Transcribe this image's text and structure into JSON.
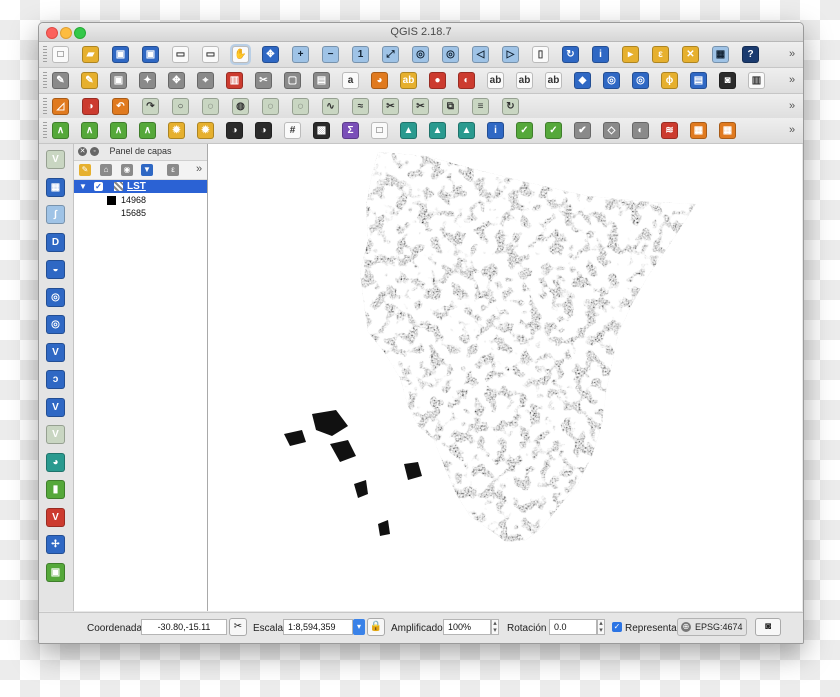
{
  "window": {
    "title": "QGIS 2.18.7"
  },
  "toolbars": {
    "more_glyph": "»",
    "row1": [
      {
        "name": "new-project",
        "glyph": "□",
        "color": "c-w"
      },
      {
        "name": "open-project",
        "glyph": "▰",
        "color": "c-y"
      },
      {
        "name": "save-project",
        "glyph": "▣",
        "color": "c-b"
      },
      {
        "name": "save-as",
        "glyph": "▣",
        "color": "c-b"
      },
      {
        "name": "new-print-composer",
        "glyph": "▭",
        "color": "c-w"
      },
      {
        "name": "composer-manager",
        "glyph": "▭",
        "color": "c-w"
      },
      {
        "name": "pan",
        "glyph": "✋",
        "color": "c-w"
      },
      {
        "name": "pan-to-selection",
        "glyph": "✥",
        "color": "c-b"
      },
      {
        "name": "zoom-in",
        "glyph": "+",
        "color": "c-lb"
      },
      {
        "name": "zoom-out",
        "glyph": "−",
        "color": "c-lb"
      },
      {
        "name": "zoom-native",
        "glyph": "1",
        "color": "c-lb"
      },
      {
        "name": "zoom-full",
        "glyph": "⤢",
        "color": "c-lb"
      },
      {
        "name": "zoom-to-selection",
        "glyph": "◎",
        "color": "c-lb"
      },
      {
        "name": "zoom-to-layer",
        "glyph": "◎",
        "color": "c-lb"
      },
      {
        "name": "zoom-last",
        "glyph": "◁",
        "color": "c-lb"
      },
      {
        "name": "zoom-next",
        "glyph": "▷",
        "color": "c-lb"
      },
      {
        "name": "bookmark",
        "glyph": "▯",
        "color": "c-w"
      },
      {
        "name": "refresh",
        "glyph": "↻",
        "color": "c-b"
      },
      {
        "name": "identify",
        "glyph": "i",
        "color": "c-b"
      },
      {
        "name": "select",
        "glyph": "▸",
        "color": "c-y"
      },
      {
        "name": "select-by-expression",
        "glyph": "ε",
        "color": "c-y"
      },
      {
        "name": "deselect",
        "glyph": "✕",
        "color": "c-y"
      },
      {
        "name": "attribute-table",
        "glyph": "▦",
        "color": "c-lb"
      },
      {
        "name": "help",
        "glyph": "?",
        "color": "c-navy"
      }
    ],
    "row2": [
      {
        "name": "current-edits",
        "glyph": "✎",
        "color": "c-gr"
      },
      {
        "name": "toggle-editing",
        "glyph": "✎",
        "color": "c-y"
      },
      {
        "name": "save-edits",
        "glyph": "▣",
        "color": "c-gr"
      },
      {
        "name": "add-feature",
        "glyph": "✦",
        "color": "c-gr"
      },
      {
        "name": "move-feature",
        "glyph": "✥",
        "color": "c-gr"
      },
      {
        "name": "node-tool",
        "glyph": "⌖",
        "color": "c-gr"
      },
      {
        "name": "delete-selected",
        "glyph": "▥",
        "color": "c-r"
      },
      {
        "name": "cut-features",
        "glyph": "✂",
        "color": "c-gr"
      },
      {
        "name": "copy-features",
        "glyph": "▢",
        "color": "c-gr"
      },
      {
        "name": "paste-features",
        "glyph": "▤",
        "color": "c-gr"
      },
      {
        "name": "label-toolbar",
        "glyph": "a",
        "color": "c-w"
      },
      {
        "name": "label-diagram",
        "glyph": "◕",
        "color": "c-o"
      },
      {
        "name": "label-layer",
        "glyph": "ab",
        "color": "c-y"
      },
      {
        "name": "pin-labels",
        "glyph": "●",
        "color": "c-r"
      },
      {
        "name": "show-hide-labels",
        "glyph": "◐",
        "color": "c-r"
      },
      {
        "name": "move-label",
        "glyph": "ab",
        "color": "c-w"
      },
      {
        "name": "rotate-label",
        "glyph": "ab",
        "color": "c-w"
      },
      {
        "name": "change-label",
        "glyph": "ab",
        "color": "c-w"
      },
      {
        "name": "database-manager",
        "glyph": "◆",
        "color": "c-b"
      },
      {
        "name": "web-layer",
        "glyph": "◎",
        "color": "c-b"
      },
      {
        "name": "wms-layer",
        "glyph": "◎",
        "color": "c-b"
      },
      {
        "name": "python-console",
        "glyph": "ϕ",
        "color": "c-y"
      },
      {
        "name": "map-tool",
        "glyph": "▤",
        "color": "c-b"
      },
      {
        "name": "screenshot",
        "glyph": "◙",
        "color": "c-k"
      },
      {
        "name": "copy-map",
        "glyph": "▥",
        "color": "c-w"
      }
    ],
    "row3": [
      {
        "name": "measure-line",
        "glyph": "◿",
        "color": "c-o"
      },
      {
        "name": "georeferencer",
        "glyph": "◑",
        "color": "c-r"
      },
      {
        "name": "undo",
        "glyph": "↶",
        "color": "c-o"
      },
      {
        "name": "redo",
        "glyph": "↷",
        "color": "c-lg"
      },
      {
        "name": "add-ring",
        "glyph": "○",
        "color": "c-lg"
      },
      {
        "name": "add-part",
        "glyph": "◌",
        "color": "c-lg"
      },
      {
        "name": "fill-ring",
        "glyph": "◍",
        "color": "c-lg"
      },
      {
        "name": "delete-ring",
        "glyph": "◌",
        "color": "c-lg"
      },
      {
        "name": "delete-part",
        "glyph": "◌",
        "color": "c-lg"
      },
      {
        "name": "reshape-features",
        "glyph": "∿",
        "color": "c-lg"
      },
      {
        "name": "offset-curve",
        "glyph": "≈",
        "color": "c-lg"
      },
      {
        "name": "split-features",
        "glyph": "✂",
        "color": "c-lg"
      },
      {
        "name": "split-parts",
        "glyph": "✂",
        "color": "c-lg"
      },
      {
        "name": "merge-features",
        "glyph": "⧉",
        "color": "c-lg"
      },
      {
        "name": "merge-attributes",
        "glyph": "≡",
        "color": "c-lg"
      },
      {
        "name": "rotate-point-symbols",
        "glyph": "↻",
        "color": "c-lg"
      }
    ],
    "row4": [
      {
        "name": "raster-histogram-stretch",
        "glyph": "∧",
        "color": "c-g"
      },
      {
        "name": "raster-local-stretch",
        "glyph": "∧",
        "color": "c-g"
      },
      {
        "name": "raster-full-stretch",
        "glyph": "∧",
        "color": "c-g"
      },
      {
        "name": "raster-cumulative-stretch",
        "glyph": "∧",
        "color": "c-g"
      },
      {
        "name": "increase-brightness",
        "glyph": "✹",
        "color": "c-y"
      },
      {
        "name": "decrease-brightness",
        "glyph": "✹",
        "color": "c-y"
      },
      {
        "name": "contrast-increase",
        "glyph": "◑",
        "color": "c-k"
      },
      {
        "name": "contrast-decrease",
        "glyph": "◑",
        "color": "c-k"
      },
      {
        "name": "grid-tool",
        "glyph": "#",
        "color": "c-w"
      },
      {
        "name": "raster-terrain",
        "glyph": "▩",
        "color": "c-k"
      },
      {
        "name": "statistics-sum",
        "glyph": "Σ",
        "color": "c-p"
      },
      {
        "name": "blank-tool",
        "glyph": "□",
        "color": "c-w"
      },
      {
        "name": "north-arrow-1",
        "glyph": "▲",
        "color": "c-t"
      },
      {
        "name": "north-arrow-2",
        "glyph": "▲",
        "color": "c-t"
      },
      {
        "name": "north-arrow-3",
        "glyph": "▲",
        "color": "c-t"
      },
      {
        "name": "info",
        "glyph": "i",
        "color": "c-b"
      },
      {
        "name": "gps-1",
        "glyph": "✓",
        "color": "c-g"
      },
      {
        "name": "gps-2",
        "glyph": "✓",
        "color": "c-g"
      },
      {
        "name": "gps-3",
        "glyph": "✔",
        "color": "c-gr"
      },
      {
        "name": "vertex-tool",
        "glyph": "◇",
        "color": "c-gr"
      },
      {
        "name": "digitize-tool",
        "glyph": "◐",
        "color": "c-gr"
      },
      {
        "name": "layers-stack",
        "glyph": "≋",
        "color": "c-r"
      },
      {
        "name": "map-tiles",
        "glyph": "▦",
        "color": "c-o"
      },
      {
        "name": "table-tool",
        "glyph": "▦",
        "color": "c-o"
      }
    ]
  },
  "left_toolbar": [
    {
      "name": "add-vector-layer",
      "glyph": "V",
      "color": "c-lg"
    },
    {
      "name": "add-raster-layer",
      "glyph": "▦",
      "color": "c-b"
    },
    {
      "name": "add-delimited-text",
      "glyph": "∫",
      "color": "c-lb"
    },
    {
      "name": "add-db2-layer",
      "glyph": "D",
      "color": "c-b"
    },
    {
      "name": "add-spatialite-layer",
      "glyph": "◒",
      "color": "c-b"
    },
    {
      "name": "add-wms-layer",
      "glyph": "◎",
      "color": "c-b"
    },
    {
      "name": "add-wcs-layer",
      "glyph": "◎",
      "color": "c-b"
    },
    {
      "name": "add-wfs-layer",
      "glyph": "V",
      "color": "c-b"
    },
    {
      "name": "add-virtual-layer",
      "glyph": "ɔ",
      "color": "c-b"
    },
    {
      "name": "add-oracle-layer",
      "glyph": "V",
      "color": "c-b"
    },
    {
      "name": "new-vector-layer",
      "glyph": "V",
      "color": "c-lg"
    },
    {
      "name": "add-wmts-layer",
      "glyph": "◕",
      "color": "c-t"
    },
    {
      "name": "new-gpx-layer",
      "glyph": "▮",
      "color": "c-g"
    },
    {
      "name": "new-virtual-layer",
      "glyph": "V",
      "color": "c-r"
    },
    {
      "name": "graph-layer",
      "glyph": "✢",
      "color": "c-b"
    },
    {
      "name": "new-spatialite-layer",
      "glyph": "▣",
      "color": "c-g"
    }
  ],
  "layers_panel": {
    "title": "Panel de capas",
    "layer": {
      "name": "LST",
      "checked": true
    },
    "legend": [
      {
        "label": "14968",
        "color": "#000000"
      },
      {
        "label": "15685",
        "color": "#ffffff"
      }
    ]
  },
  "statusbar": {
    "coordinate_label": "Coordenada",
    "coordinate_value": "-30.80,-15.11",
    "scale_label": "Escala",
    "scale_value": "1:8,594,359",
    "magnifier_label": "Amplificador",
    "magnifier_value": "100%",
    "rotation_label": "Rotación",
    "rotation_value": "0.0",
    "render_label": "Representar",
    "render_checked": true,
    "crs": "EPSG:4674"
  }
}
